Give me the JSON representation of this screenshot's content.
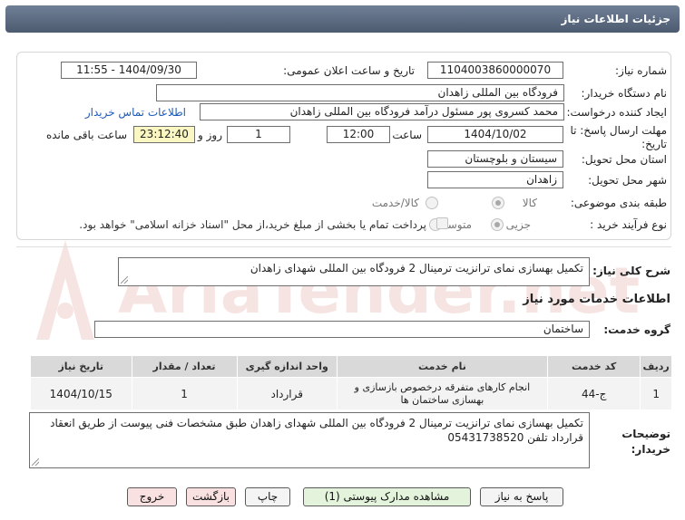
{
  "header": {
    "title": "جزئیات اطلاعات نیاز"
  },
  "form": {
    "need_number_label": "شماره نیاز:",
    "need_number": "1104003860000070",
    "announce_label": "تاریخ و ساعت اعلان عمومی:",
    "announce_value": "1404/09/30 - 11:55",
    "buyer_org_label": "نام دستگاه خریدار:",
    "buyer_org": "فرودگاه بین المللی زاهدان",
    "requester_label": "ایجاد کننده درخواست:",
    "requester": "محمد کسروی پور مسئول درآمد فرودگاه بین المللی زاهدان",
    "contact_link": "اطلاعات تماس خریدار",
    "deadline_label": "مهلت ارسال پاسخ: تا تاریخ:",
    "deadline_date": "1404/10/02",
    "time_label": "ساعت",
    "deadline_time": "12:00",
    "days_value": "1",
    "days_label": "روز و",
    "remaining_time": "23:12:40",
    "remaining_label": "ساعت باقی مانده",
    "province_label": "استان محل تحویل:",
    "province": "سیستان و بلوچستان",
    "city_label": "شهر محل تحویل:",
    "city": "زاهدان",
    "category_label": "طبقه بندی موضوعی:",
    "category_options": [
      "کالا",
      "کالا/خدمت"
    ],
    "process_label": "نوع فرآیند خرید :",
    "process_options": [
      "جزیی",
      "متوسط"
    ],
    "payment_note": "پرداخت تمام یا بخشی از مبلغ خرید،از محل \"اسناد خزانه اسلامی\" خواهد بود."
  },
  "summary": {
    "label": "شرح کلی نیاز:",
    "text": "تکمیل بهسازی نمای ترانزیت ترمینال 2 فرودگاه بین المللی شهدای زاهدان"
  },
  "services": {
    "heading": "اطلاعات خدمات مورد نیاز",
    "group_label": "گروه خدمت:",
    "group_value": "ساختمان",
    "columns": [
      "ردیف",
      "کد خدمت",
      "نام خدمت",
      "واحد اندازه گیری",
      "تعداد / مقدار",
      "تاریخ نیاز"
    ],
    "rows": [
      {
        "row": "1",
        "code": "ج-44",
        "name": "انجام کارهای متفرقه درخصوص بازسازی و بهسازی ساختمان ها",
        "unit": "قرارداد",
        "qty": "1",
        "date": "1404/10/15"
      }
    ]
  },
  "notes": {
    "label": "توضیحات خریدار:",
    "text": "تکمیل بهسازی نمای ترانزیت ترمینال 2 فرودگاه بین المللی شهدای زاهدان طبق مشخصات فنی پیوست از طریق انعقاد قرارداد تلفن 05431738520"
  },
  "buttons": {
    "reply": "پاسخ به نیاز",
    "attachments": "مشاهده مدارک پیوستی (1)",
    "print": "چاپ",
    "back": "بازگشت",
    "exit": "خروج"
  },
  "watermark_text": "AriaTender.net",
  "colors": {
    "title_bar": "#5b6a80",
    "link": "#1f5cb5",
    "table_header": "#d9d9d9",
    "remaining_bg": "#fbf7c2",
    "watermark": "#c0392b"
  }
}
